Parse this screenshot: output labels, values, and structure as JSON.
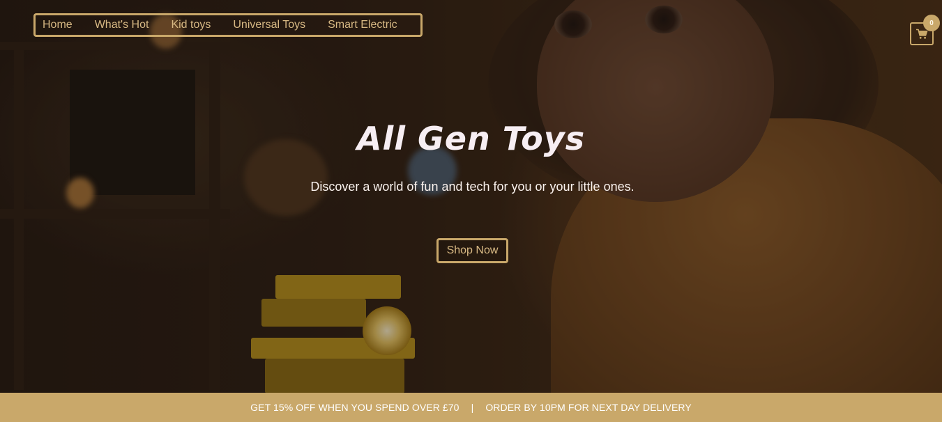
{
  "brand": {
    "title": "All Gen Toys",
    "tagline": "Discover a world of fun and tech for you or your little ones."
  },
  "nav": {
    "items": [
      {
        "label": "Home"
      },
      {
        "label": "What's Hot"
      },
      {
        "label": "Kid toys"
      },
      {
        "label": "Universal Toys"
      },
      {
        "label": "Smart Electric"
      }
    ]
  },
  "cart": {
    "icon": "cart-icon",
    "count": "0"
  },
  "hero": {
    "cta_label": "Shop Now"
  },
  "promo_bar": {
    "left_text": "GET 15% OFF WHEN YOU SPEND OVER £70",
    "separator": "|",
    "right_text": "ORDER BY 10PM FOR NEXT DAY DELIVERY"
  },
  "colors": {
    "accent": "#c9a86a",
    "nav_text": "#d8b984",
    "title_text": "#f7eef3"
  }
}
